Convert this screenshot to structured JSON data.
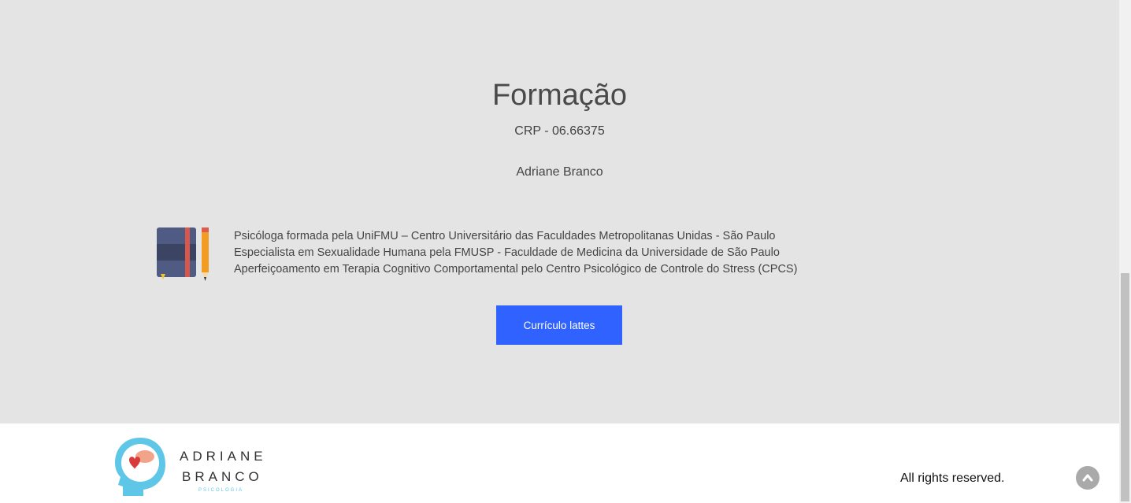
{
  "section": {
    "title": "Formação",
    "crp": "CRP - 06.66375",
    "name": "Adriane Branco",
    "bio_lines": [
      "Psicóloga formada pela UniFMU – Centro Universitário das Faculdades Metropolitanas Unidas - São Paulo",
      "Especialista em Sexualidade Humana pela FMUSP - Faculdade de Medicina da Universidade de São Paulo",
      "Aperfeiçoamento em Terapia Cognitivo Comportamental pelo Centro Psicológico de Controle do Stress (CPCS)"
    ],
    "button_label": "Currículo lattes",
    "icon": "book-pencil-icon"
  },
  "footer": {
    "logo_line1": "ADRIANE",
    "logo_line2": "BRANCO",
    "logo_sub": "PSICOLOGIA",
    "rights": "All rights reserved."
  },
  "colors": {
    "section_bg": "#e4e4e4",
    "button_bg": "#2f62fe",
    "accent_blue": "#5ec7e8"
  }
}
